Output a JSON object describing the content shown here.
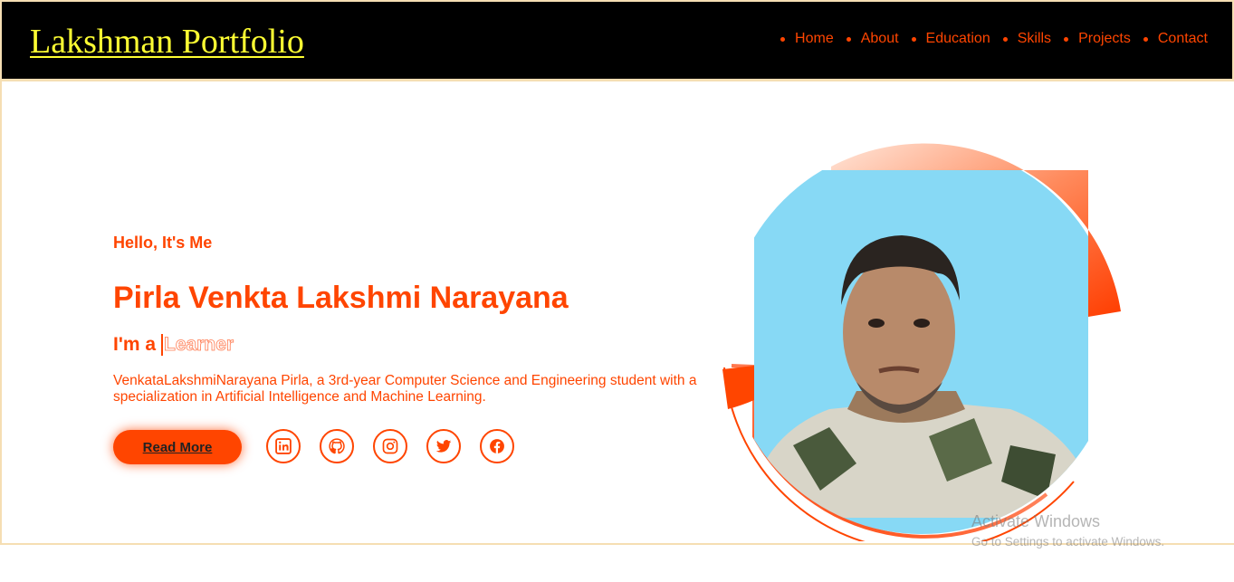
{
  "header": {
    "logo": "Lakshman Portfolio",
    "nav": [
      "Home",
      "About",
      "Education",
      "Skills",
      "Projects",
      "Contact"
    ]
  },
  "hero": {
    "greeting": "Hello, It's Me",
    "name": "Pirla Venkta Lakshmi Narayana",
    "role_prefix": "I'm a",
    "role_typed": "Learner",
    "bio": "VenkataLakshmiNarayana Pirla, a 3rd-year Computer Science and Engineering student with a specialization in Artificial Intelligence and Machine Learning.",
    "read_more": "Read More",
    "socials": [
      "linkedin-icon",
      "github-icon",
      "instagram-icon",
      "twitter-icon",
      "facebook-icon"
    ]
  },
  "watermark": {
    "line1": "Activate Windows",
    "line2": "Go to Settings to activate Windows."
  },
  "colors": {
    "accent": "#ff4500",
    "logo": "#ffff33",
    "header_bg": "#000000",
    "border": "#f5deb3",
    "photo_bg": "#87d9f5"
  }
}
